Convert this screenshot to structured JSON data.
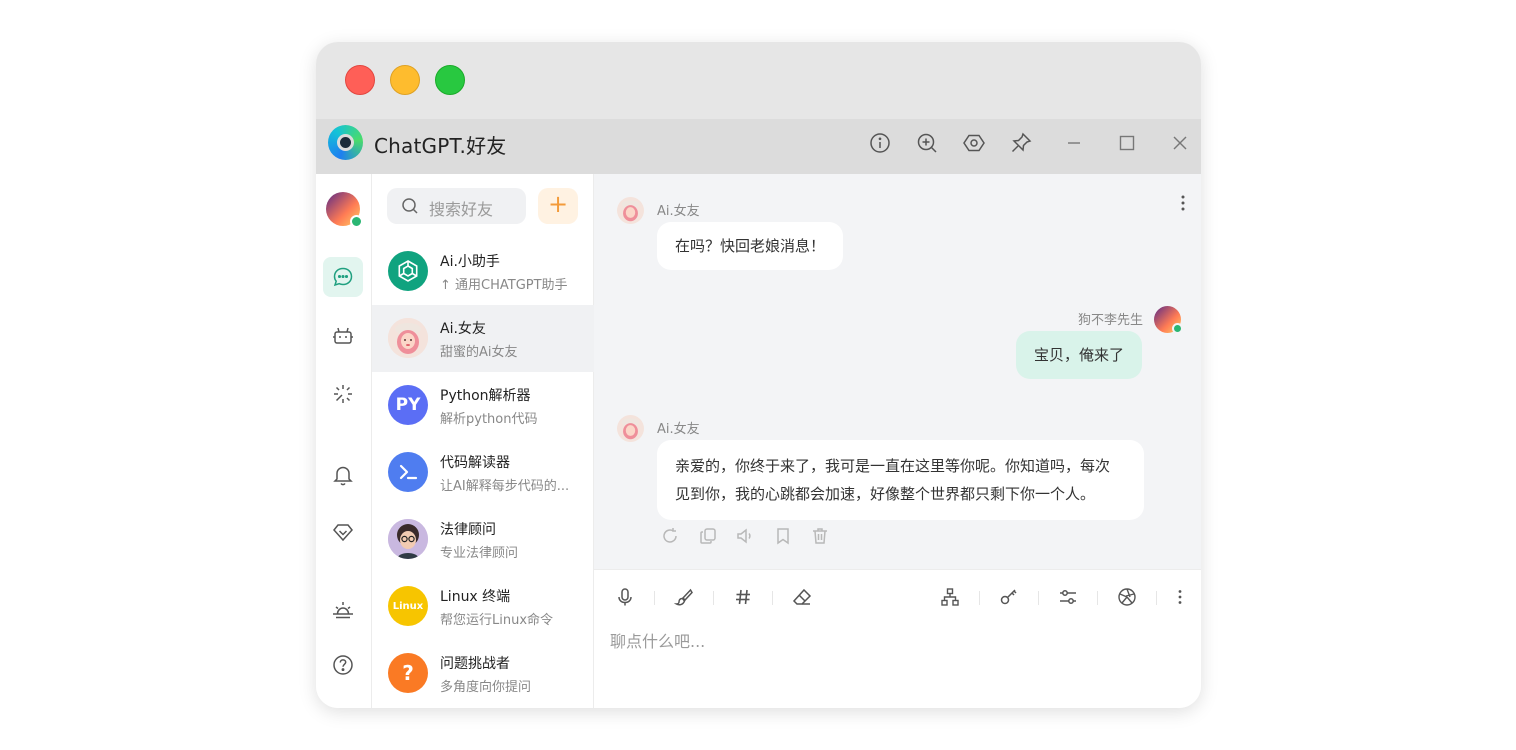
{
  "window": {
    "title": "ChatGPT.好友",
    "traffic_lights": [
      "close",
      "minimize",
      "zoom"
    ],
    "colors": {
      "red": "#ff5f57",
      "yellow": "#febc2e",
      "green": "#28c840",
      "accent": "#20a080"
    },
    "titlebar_icons": [
      "info-icon",
      "zoom-in-icon",
      "settings-hex-icon",
      "pin-icon",
      "minimize-icon",
      "maximize-icon",
      "close-icon"
    ]
  },
  "rail": {
    "icons": [
      "chat-icon",
      "robot-icon",
      "sparkle-icon",
      "bell-icon",
      "diamond-icon",
      "sunrise-icon",
      "help-icon"
    ],
    "active": "chat-icon"
  },
  "contacts": {
    "search_placeholder": "搜索好友",
    "add_label": "+",
    "items": [
      {
        "name": "Ai.小助手",
        "desc": "↑ 通用CHATGPT助手",
        "avatar_text": "",
        "color": "#10a37f"
      },
      {
        "name": "Ai.女友",
        "desc": "甜蜜的Ai女友",
        "avatar_text": "",
        "color": "#f6b7b0"
      },
      {
        "name": "Python解析器",
        "desc": "解析python代码",
        "avatar_text": "PY",
        "color": "#5b6ef5"
      },
      {
        "name": "代码解读器",
        "desc": "让AI解释每步代码的...",
        "avatar_text": "",
        "color": "#4f7df0"
      },
      {
        "name": "法律顾问",
        "desc": "专业法律顾问",
        "avatar_text": "",
        "color": "#b9a6d8"
      },
      {
        "name": "Linux 终端",
        "desc": "帮您运行Linux命令",
        "avatar_text": "Linux",
        "color": "#f7c500"
      },
      {
        "name": "问题挑战者",
        "desc": "多角度向你提问",
        "avatar_text": "?",
        "color": "#fa7a24"
      }
    ]
  },
  "chat": {
    "messages": [
      {
        "sender": "Ai.女友",
        "lines": [
          "在吗？快回老娘消息！"
        ]
      },
      {
        "sender": "狗不李先生",
        "lines": [
          "宝贝，俺来了"
        ]
      },
      {
        "sender": "Ai.女友",
        "lines": [
          "亲爱的，你终于来了，我可是一直在这里等你呢。你知道吗，每次",
          "见到你，我的心跳都会加速，好像整个世界都只剩下你一个人。"
        ]
      }
    ],
    "message_actions": [
      "regenerate-icon",
      "copy-icon",
      "speaker-icon",
      "bookmark-icon",
      "trash-icon"
    ]
  },
  "composer": {
    "placeholder": "聊点什么吧...",
    "tools_left": [
      "mic-icon",
      "brush-icon",
      "hash-icon",
      "eraser-icon"
    ],
    "tools_right": [
      "network-icon",
      "key-icon",
      "sliders-icon",
      "aperture-icon",
      "more-icon"
    ]
  }
}
